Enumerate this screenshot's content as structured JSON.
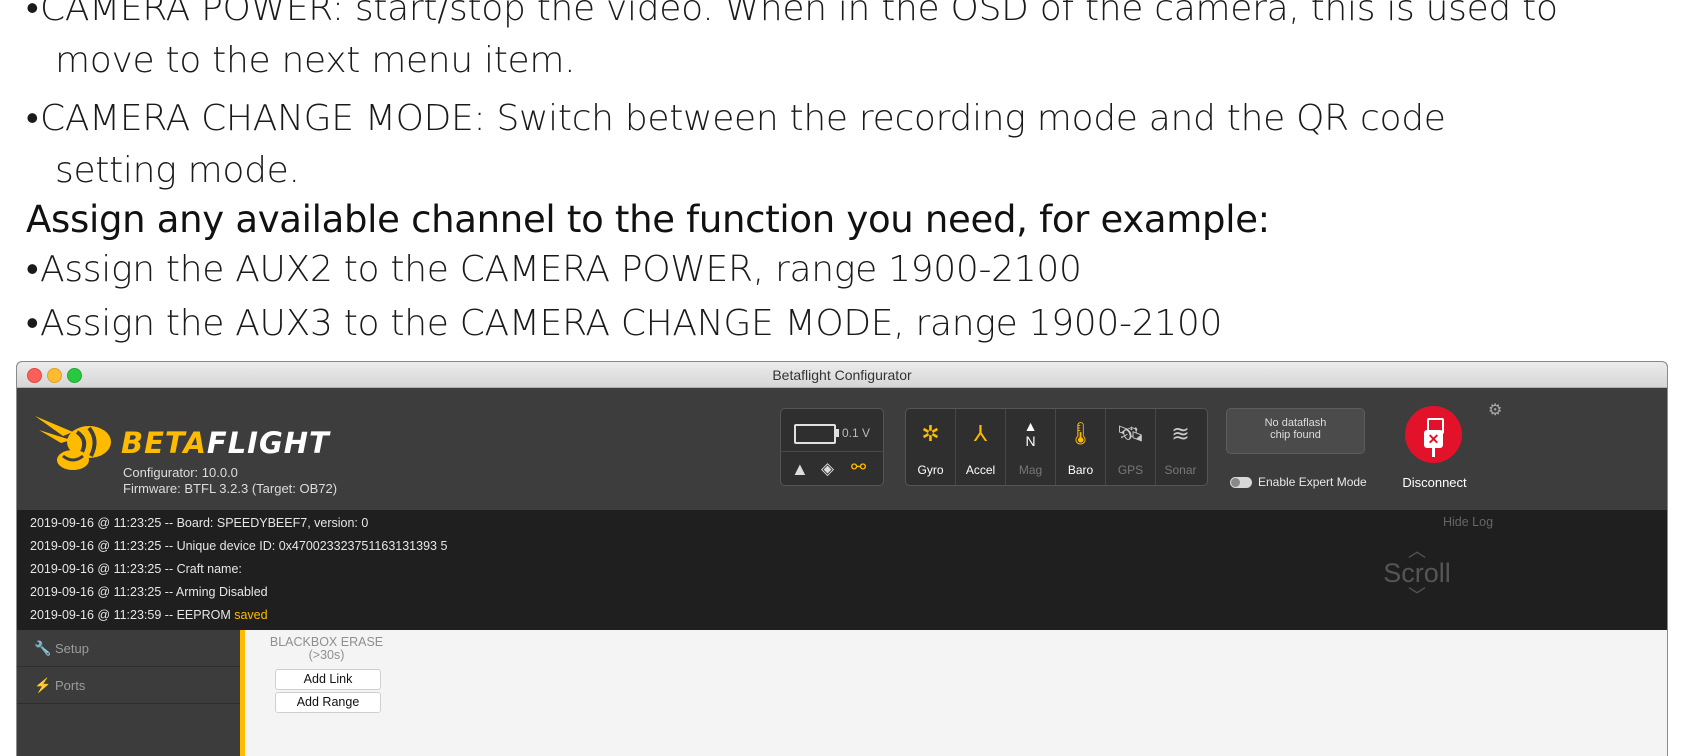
{
  "document": {
    "lines": [
      "CAMERA POWER: start/stop the video. When in the OSD of the camera, this is used to",
      "move to the next menu item.",
      "CAMERA CHANGE MODE: Switch between the recording mode and the QR code",
      "setting mode.",
      "Assign any available channel to the function you need, for example:",
      "Assign the AUX2 to the CAMERA POWER, range 1900-2100",
      "Assign the AUX3 to the CAMERA CHANGE MODE, range 1900-2100"
    ],
    "bullet": "•"
  },
  "window": {
    "title": "Betaflight Configurator"
  },
  "header": {
    "logo_beta": "BETA",
    "logo_flight": "FLIGHT",
    "configurator_version": "Configurator: 10.0.0",
    "firmware_version": "Firmware: BTFL 3.2.3 (Target: OB72)",
    "voltage": "0.1 V",
    "sensors": [
      {
        "label": "Gyro",
        "icon": "gyro-icon",
        "active": true
      },
      {
        "label": "Accel",
        "icon": "accel-icon",
        "active": true
      },
      {
        "label": "Mag",
        "icon": "mag-icon",
        "active": false,
        "glyph": "N"
      },
      {
        "label": "Baro",
        "icon": "baro-icon",
        "active": true
      },
      {
        "label": "GPS",
        "icon": "gps-icon",
        "active": false
      },
      {
        "label": "Sonar",
        "icon": "sonar-icon",
        "active": false
      }
    ],
    "dataflash_line1": "No dataflash",
    "dataflash_line2": "chip found",
    "expert_mode_label": "Enable Expert Mode",
    "disconnect_label": "Disconnect"
  },
  "log": {
    "hide_label": "Hide Log",
    "scroll_label": "Scroll",
    "entries": [
      "2019-09-16 @ 11:23:25 -- Board: SPEEDYBEEF7, version: 0",
      "2019-09-16 @ 11:23:25 -- Unique device ID: 0x470023323751163131393 5",
      "2019-09-16 @ 11:23:25 -- Craft name:",
      "2019-09-16 @ 11:23:25 -- Arming Disabled",
      "2019-09-16 @ 11:23:59 -- EEPROM "
    ],
    "saved_word": "saved"
  },
  "tabs": [
    {
      "label": "Setup",
      "icon": "wrench-icon"
    },
    {
      "label": "Ports",
      "icon": "plug-icon"
    }
  ],
  "mode": {
    "name_line1": "BLACKBOX ERASE",
    "name_line2": "(>30s)",
    "add_link": "Add Link",
    "add_range": "Add Range"
  },
  "colors": {
    "brand_yellow": "#ffbb00",
    "disconnect_red": "#e2122a"
  }
}
